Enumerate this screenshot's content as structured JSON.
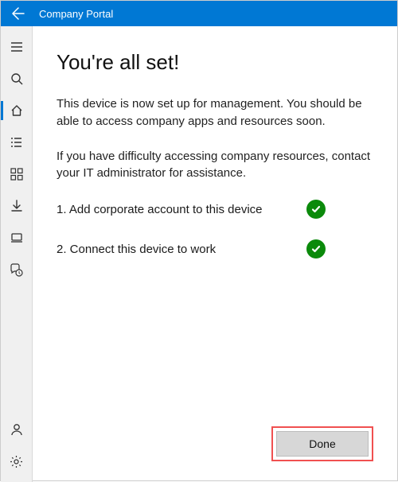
{
  "titlebar": {
    "title": "Company Portal"
  },
  "main": {
    "heading": "You're all set!",
    "para1": "This device is now set up for management.  You should be able to access company apps and resources soon.",
    "para2": "If you have difficulty accessing company resources, contact your IT administrator for assistance.",
    "steps": [
      {
        "label": "1. Add corporate account to this device",
        "status": "complete"
      },
      {
        "label": "2. Connect this device to work",
        "status": "complete"
      }
    ],
    "done_label": "Done"
  },
  "sidebar": {
    "items": [
      {
        "id": "menu-icon"
      },
      {
        "id": "search-icon"
      },
      {
        "id": "home-icon",
        "active": true
      },
      {
        "id": "list-icon"
      },
      {
        "id": "apps-icon"
      },
      {
        "id": "download-icon"
      },
      {
        "id": "device-icon"
      },
      {
        "id": "support-icon"
      }
    ],
    "bottom": [
      {
        "id": "person-icon"
      },
      {
        "id": "settings-icon"
      }
    ]
  },
  "colors": {
    "brand": "#0078d4",
    "success": "#0b8a0b",
    "highlight": "#f05050"
  }
}
